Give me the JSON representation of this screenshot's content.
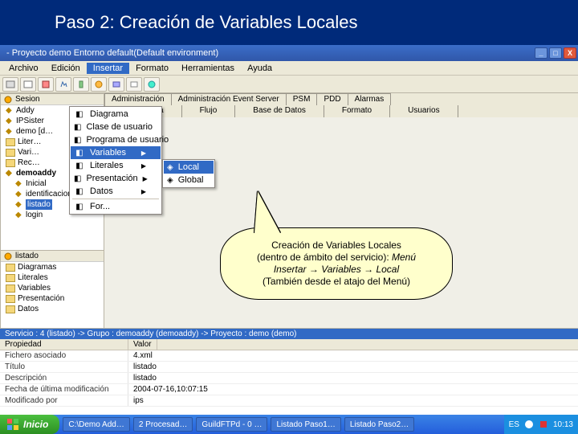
{
  "slide": {
    "title": "Paso 2: Creación de Variables Locales"
  },
  "window": {
    "title": "- Proyecto demo Entorno default(Default environment)",
    "controls": {
      "min": "_",
      "max": "□",
      "close": "X"
    }
  },
  "menubar": [
    "Archivo",
    "Edición",
    "Insertar",
    "Formato",
    "Herramientas",
    "Ayuda"
  ],
  "menubar_open_index": 2,
  "dd1": [
    {
      "icon": "diagram-icon",
      "label": "Diagrama"
    },
    {
      "icon": "class-icon",
      "label": "Clase de usuario"
    },
    {
      "icon": "program-icon",
      "label": "Programa de usuario"
    },
    {
      "icon": "var-icon",
      "label": "Variables",
      "sub": true,
      "hi": true
    },
    {
      "icon": "lit-icon",
      "label": "Literales",
      "sub": true
    },
    {
      "icon": "pres-icon",
      "label": "Presentación",
      "sub": true
    },
    {
      "icon": "data-icon",
      "label": "Datos",
      "sub": true
    },
    {
      "sep": true
    },
    {
      "icon": "for-icon",
      "label": "For..."
    }
  ],
  "dd2": [
    {
      "icon": "local-icon",
      "label": "Local",
      "hi": true
    },
    {
      "icon": "global-icon",
      "label": "Global"
    }
  ],
  "tabs_row1": [
    "Administración",
    "Administración Event Server",
    "PSM",
    "PDD",
    "Alarmas"
  ],
  "tabs_row2": [
    "Miscelánea",
    "Flujo",
    "Base de Datos",
    "Formato",
    "Usuarios"
  ],
  "tree_header": "Sesion",
  "tree1": [
    {
      "label": "Addy"
    },
    {
      "label": "IPSister"
    },
    {
      "label": "demo [d…"
    },
    {
      "label": "Liter…",
      "folder": true
    },
    {
      "label": "Vari…",
      "folder": true
    },
    {
      "label": "Rec…",
      "folder": true
    },
    {
      "label": "demoaddy",
      "bold": true,
      "children": [
        {
          "label": "Inicial"
        },
        {
          "label": "identificacion"
        },
        {
          "label": "listado",
          "sel": true
        },
        {
          "label": "login"
        }
      ]
    }
  ],
  "tree2_header": "listado",
  "tree2": [
    {
      "label": "Diagramas",
      "folder": true
    },
    {
      "label": "Literales",
      "folder": true
    },
    {
      "label": "Variables",
      "folder": true
    },
    {
      "label": "Presentación",
      "folder": true
    },
    {
      "label": "Datos",
      "folder": true
    }
  ],
  "callout": {
    "l1": "Creación de Variables Locales",
    "l2_a": "(dentro de ámbito del servicio): ",
    "l2_b": "Menú",
    "l3": "Insertar → Variables → Local",
    "l4": "(También desde el atajo del Menú)"
  },
  "propgrid": {
    "heading": "Servicio : 4 (listado)  -> Grupo : demoaddy (demoaddy)  -> Proyecto : demo (demo)",
    "col1": "Propiedad",
    "col2": "Valor",
    "rows": [
      {
        "k": "Fichero asociado",
        "v": "4.xml"
      },
      {
        "k": "Título",
        "v": "listado"
      },
      {
        "k": "Descripción",
        "v": "listado"
      },
      {
        "k": "Fecha de última modificación",
        "v": "2004-07-16,10:07:15"
      },
      {
        "k": "Modificado por",
        "v": "ips"
      }
    ]
  },
  "taskbar": {
    "start": "Inicio",
    "tasks": [
      "C:\\Demo Add…",
      "2 Procesad…",
      "GuildFTPd - 0 …",
      "Listado Paso1…",
      "Listado Paso2…"
    ],
    "lang": "ES",
    "clock": "10:13"
  }
}
